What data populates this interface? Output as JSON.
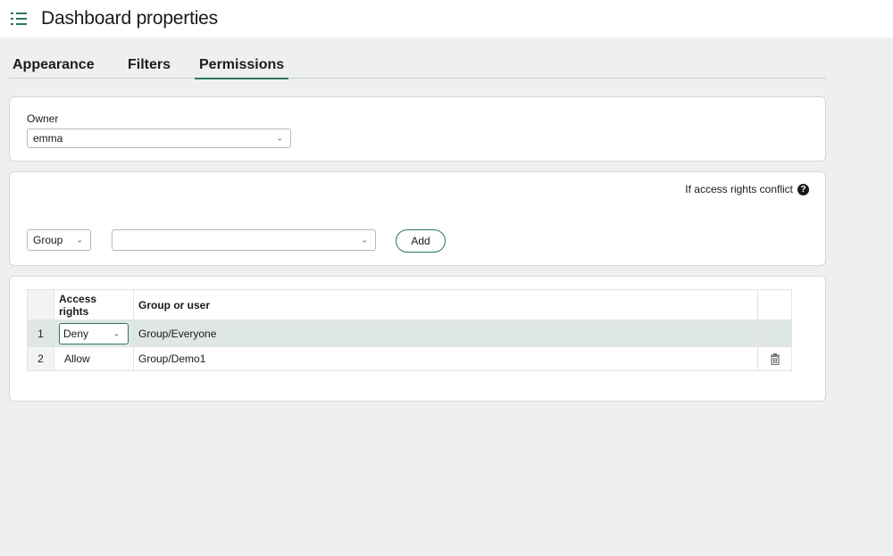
{
  "header": {
    "title": "Dashboard properties",
    "icon": "list-icon"
  },
  "tabs": [
    {
      "label": "Appearance",
      "active": false
    },
    {
      "label": "Filters",
      "active": false
    },
    {
      "label": "Permissions",
      "active": true
    }
  ],
  "owner": {
    "label": "Owner",
    "value": "emma"
  },
  "access": {
    "conflict_label": "If access rights conflict",
    "type_value": "Group",
    "member_value": "",
    "add_label": "Add"
  },
  "table": {
    "columns": [
      "Access rights",
      "Group or user"
    ],
    "rows": [
      {
        "num": "1",
        "rights": "Deny",
        "member": "Group/Everyone",
        "selected": true
      },
      {
        "num": "2",
        "rights": "Allow",
        "member": "Group/Demo1",
        "selected": false
      }
    ]
  },
  "colors": {
    "accent": "#2b7a57",
    "background": "#eef0f0",
    "selected_row": "#dfe7e6"
  }
}
